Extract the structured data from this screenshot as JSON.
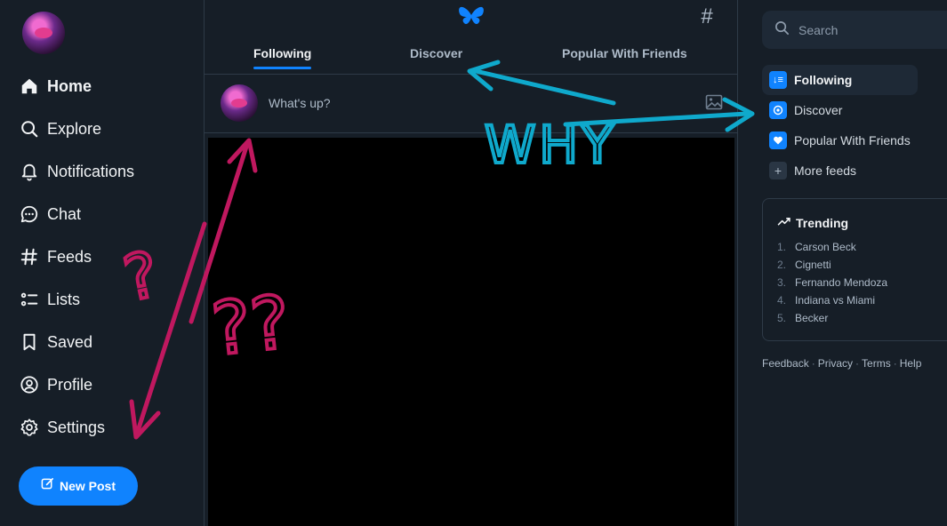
{
  "sidebar": {
    "items": [
      {
        "label": "Home",
        "icon": "home-icon"
      },
      {
        "label": "Explore",
        "icon": "search-icon"
      },
      {
        "label": "Notifications",
        "icon": "bell-icon"
      },
      {
        "label": "Chat",
        "icon": "chat-icon"
      },
      {
        "label": "Feeds",
        "icon": "hash-icon"
      },
      {
        "label": "Lists",
        "icon": "list-icon"
      },
      {
        "label": "Saved",
        "icon": "bookmark-icon"
      },
      {
        "label": "Profile",
        "icon": "user-circle-icon"
      },
      {
        "label": "Settings",
        "icon": "gear-icon"
      }
    ],
    "new_post_label": "New Post"
  },
  "header": {
    "tabs": [
      {
        "label": "Following"
      },
      {
        "label": "Discover"
      },
      {
        "label": "Popular With Friends"
      }
    ]
  },
  "composer": {
    "placeholder": "What's up?"
  },
  "right": {
    "search_placeholder": "Search",
    "feeds": [
      {
        "label": "Following"
      },
      {
        "label": "Discover"
      },
      {
        "label": "Popular With Friends"
      },
      {
        "label": "More feeds"
      }
    ],
    "trending": {
      "title": "Trending",
      "items": [
        {
          "num": "1.",
          "label": "Carson Beck"
        },
        {
          "num": "2.",
          "label": "Cignetti"
        },
        {
          "num": "3.",
          "label": "Fernando Mendoza"
        },
        {
          "num": "4.",
          "label": "Indiana vs Miami"
        },
        {
          "num": "5.",
          "label": "Becker"
        }
      ]
    },
    "footer": {
      "feedback": "Feedback",
      "privacy": "Privacy",
      "terms": "Terms",
      "help": "Help"
    }
  },
  "annotations": {
    "why_text": "WHY",
    "question_marks": [
      "?",
      "??"
    ]
  },
  "colors": {
    "background": "#161e27",
    "accent": "#1083fe",
    "annotation_magenta": "#c0185f",
    "annotation_cyan": "#0fa9cc"
  }
}
